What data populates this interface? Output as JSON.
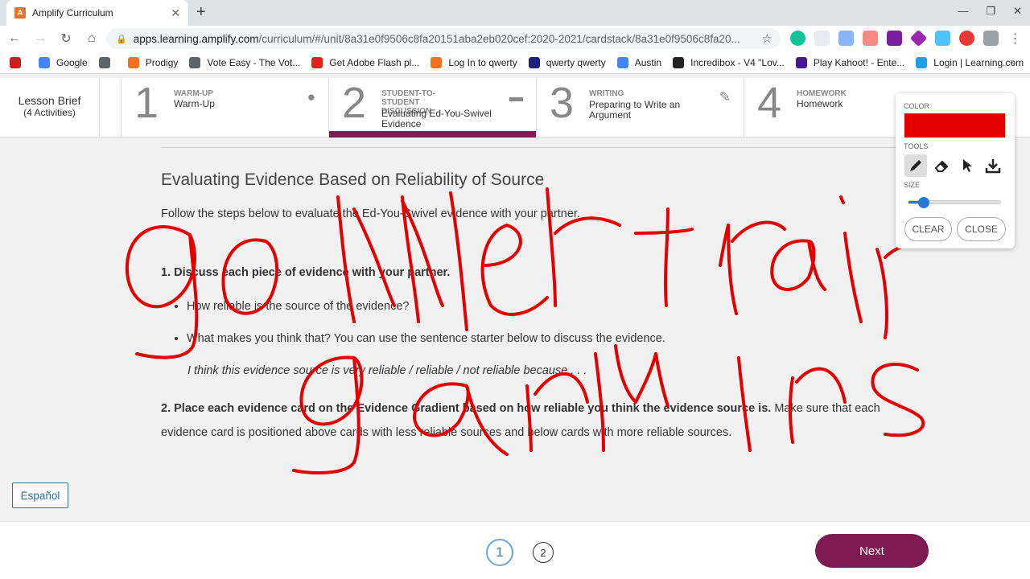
{
  "browser": {
    "tab_title": "Amplify Curriculum",
    "tab_favicon": "A",
    "new_tab": "+",
    "url_domain": "apps.learning.amplify.com",
    "url_path": "/curriculum/#/unit/8a31e0f9506c8fa20151aba2eb020cef:2020-2021/cardstack/8a31e0f9506c8fa20...",
    "bookmarks": [
      {
        "label": "",
        "color": "#c5221f",
        "icon": "apps-icon"
      },
      {
        "label": "Google",
        "color": "#4285f4",
        "icon": "google-icon"
      },
      {
        "label": "",
        "color": "#5f6368",
        "icon": "globe-icon"
      },
      {
        "label": "Prodigy",
        "color": "#f37021",
        "icon": "prodigy-icon"
      },
      {
        "label": "Vote Easy - The Vot...",
        "color": "#5f6368",
        "icon": "vote-icon"
      },
      {
        "label": "Get Adobe Flash pl...",
        "color": "#e2231a",
        "icon": "adobe-icon"
      },
      {
        "label": "Log In to qwerty",
        "color": "#f37021",
        "icon": "amplify-icon"
      },
      {
        "label": "qwerty qwerty",
        "color": "#1a237e",
        "icon": "bird-icon"
      },
      {
        "label": "Austin",
        "color": "#4285f4",
        "icon": "docs-icon"
      },
      {
        "label": "Incredibox - V4 \"Lov...",
        "color": "#222222",
        "icon": "incredibox-icon"
      },
      {
        "label": "Play Kahoot! - Ente...",
        "color": "#46178f",
        "icon": "kahoot-icon"
      },
      {
        "label": "Login | Learning.com",
        "color": "#1fa0e0",
        "icon": "learning-icon"
      }
    ],
    "bookmarks_more": "»"
  },
  "lesson": {
    "brief_title": "Lesson Brief",
    "brief_count": "(4 Activities)",
    "steps": [
      {
        "num": "1",
        "category": "WARM-UP",
        "title": "Warm-Up",
        "icon": "lightbulb-head-icon"
      },
      {
        "num": "2",
        "category": "STUDENT-TO-STUDENT DISCUSSION",
        "title": "Evaluating Ed-You-Swivel Evidence",
        "icon": "chat-bubbles-icon"
      },
      {
        "num": "3",
        "category": "WRITING",
        "title": "Preparing to Write an Argument",
        "icon": "pencil-icon"
      },
      {
        "num": "4",
        "category": "HOMEWORK",
        "title": "Homework",
        "icon": "house-icon"
      }
    ]
  },
  "content": {
    "heading": "Evaluating Evidence Based on Reliability of Source",
    "intro": "Follow the steps below to evaluate the Ed-You-Swivel evidence with your partner.",
    "step1": "1. Discuss each piece of evidence with your partner.",
    "bullets": [
      "How reliable is the source of the evidence?",
      "What makes you think that? You can use the sentence starter below to discuss the evidence."
    ],
    "starter": "I think this evidence source is very reliable / reliable / not reliable because . . .",
    "step2_bold": "2. Place each evidence card on the Evidence Gradient based on how reliable you think the evidence source is.",
    "step2_rest": " Make sure that each evidence card is positioned above cards with less reliable sources and below cards with more reliable sources."
  },
  "espanol_label": "Español",
  "pagination": {
    "current": "1",
    "next_page": "2"
  },
  "next_label": "Next",
  "draw_panel": {
    "color_label": "COLOR",
    "selected_color": "#e50000",
    "tools_label": "TOOLS",
    "size_label": "SIZE",
    "size_value": 0.17,
    "clear_label": "CLEAR",
    "close_label": "CLOSE"
  },
  "accent_color": "#7e1b54"
}
